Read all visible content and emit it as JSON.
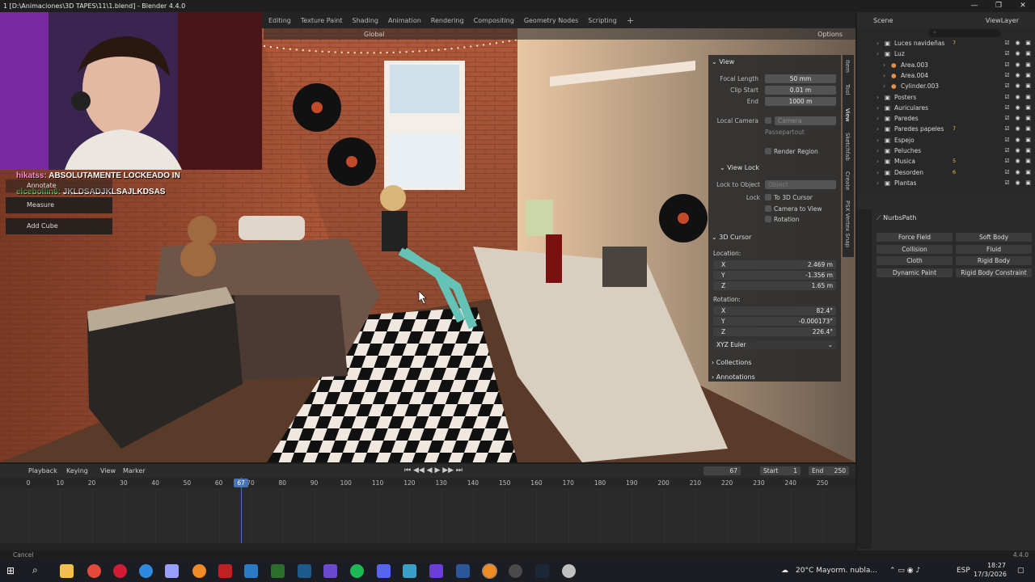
{
  "window": {
    "title": "1 [D:\\Animaciones\\3D TAPES\\11\\1.blend] - Blender 4.4.0",
    "controls": [
      "—",
      "❐",
      "✕"
    ]
  },
  "workspace_tabs": [
    "Editing",
    "Texture Paint",
    "Shading",
    "Animation",
    "Rendering",
    "Compositing",
    "Geometry Nodes",
    "Scripting",
    "+"
  ],
  "viewport_header": {
    "orientation": "Global",
    "options_label": "Options"
  },
  "chat": [
    {
      "user": "hikatss:",
      "message": "ABSOLUTAMENTE LOCKEADO IN"
    },
    {
      "user": "elcebollin6:",
      "message": "JKLDSADJKLSAJLKDSAS"
    }
  ],
  "tool_popup": {
    "items": [
      "Annotate",
      "Measure",
      "Add Cube"
    ]
  },
  "npanel": {
    "tabs": [
      "Item",
      "Tool",
      "View",
      "Sketchfab",
      "Create",
      "PSX Vertex Snap"
    ],
    "view": {
      "header": "View",
      "focal_length_label": "Focal Length",
      "focal_length": "50 mm",
      "clip_start_label": "Clip Start",
      "clip_start": "0.01 m",
      "clip_end_label": "End",
      "clip_end": "1000 m",
      "local_camera_label": "Local Camera",
      "local_camera_value": "Camera",
      "passepartout": "Passepartout",
      "render_region": "Render Region"
    },
    "view_lock": {
      "header": "View Lock",
      "lock_to_object_label": "Lock to Object",
      "lock_to_object_placeholder": "Object",
      "lock_label": "Lock",
      "lock_3d_cursor": "To 3D Cursor",
      "camera_to_view": "Camera to View",
      "rotation": "Rotation"
    },
    "cursor": {
      "header": "3D Cursor",
      "location_label": "Location:",
      "loc_x": "2.469 m",
      "loc_y": "-1.356 m",
      "loc_z": "1.65 m",
      "rotation_label": "Rotation:",
      "rot_x": "82.4°",
      "rot_y": "-0.000173°",
      "rot_z": "226.4°",
      "rotation_mode": "XYZ Euler"
    },
    "collections": "Collections",
    "annotations": "Annotations"
  },
  "outliner": {
    "scene": "Scene",
    "view_layer": "ViewLayer",
    "rows": [
      {
        "name": "Luces navideñas",
        "indent": 1,
        "count": "7"
      },
      {
        "name": "Luz",
        "indent": 1,
        "count": ""
      },
      {
        "name": "Area.003",
        "indent": 2,
        "count": ""
      },
      {
        "name": "Area.004",
        "indent": 2,
        "count": ""
      },
      {
        "name": "Cylinder.003",
        "indent": 2,
        "count": ""
      },
      {
        "name": "Posters",
        "indent": 1,
        "count": ""
      },
      {
        "name": "Auriculares",
        "indent": 1,
        "count": ""
      },
      {
        "name": "Paredes",
        "indent": 1,
        "count": ""
      },
      {
        "name": "Paredes papeles",
        "indent": 1,
        "count": "7"
      },
      {
        "name": "Espejo",
        "indent": 1,
        "count": ""
      },
      {
        "name": "Peluches",
        "indent": 1,
        "count": ""
      },
      {
        "name": "Musica",
        "indent": 1,
        "count": "5"
      },
      {
        "name": "Desorden",
        "indent": 1,
        "count": "6"
      },
      {
        "name": "Plantas",
        "indent": 1,
        "count": ""
      }
    ]
  },
  "properties": {
    "object_name": "NurbsPath",
    "physics_buttons": [
      [
        "Force Field",
        "Soft Body"
      ],
      [
        "Collision",
        "Fluid"
      ],
      [
        "Cloth",
        "Rigid Body"
      ],
      [
        "Dynamic Paint",
        "Rigid Body Constraint"
      ]
    ]
  },
  "timeline": {
    "menus": [
      "Playback",
      "Keying",
      "View",
      "Marker"
    ],
    "current_frame": "67",
    "start_label": "Start",
    "start": "1",
    "end_label": "End",
    "end": "250",
    "ticks": [
      "0",
      "10",
      "20",
      "30",
      "40",
      "50",
      "60",
      "70",
      "80",
      "90",
      "100",
      "110",
      "120",
      "130",
      "140",
      "150",
      "160",
      "170",
      "180",
      "190",
      "200",
      "210",
      "220",
      "230",
      "240",
      "250"
    ]
  },
  "status": {
    "left": "Cancel",
    "version": "4.4.0"
  },
  "taskbar": {
    "weather": "20°C  Mayorm. nubla...",
    "lang": "ESP",
    "time": "18:27",
    "date": "17/3/2026"
  },
  "colors": {
    "accent": "#4772b3",
    "playhead": "#4772b3",
    "panel": "#2e2e2e"
  }
}
